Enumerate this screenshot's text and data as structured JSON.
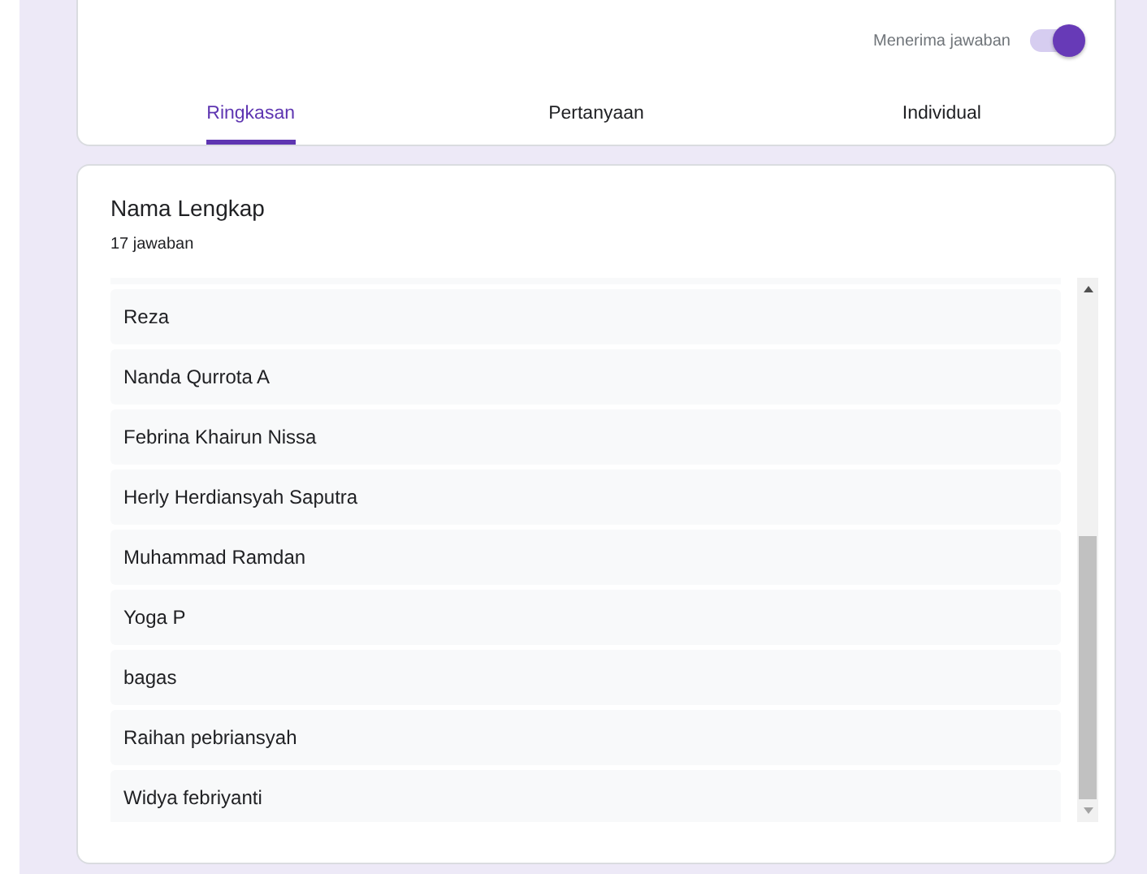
{
  "header": {
    "toggle": {
      "label": "Menerima jawaban",
      "on": true
    }
  },
  "tabs": [
    {
      "label": "Ringkasan",
      "selected": true
    },
    {
      "label": "Pertanyaan",
      "selected": false
    },
    {
      "label": "Individual",
      "selected": false
    }
  ],
  "question": {
    "title": "Nama Lengkap",
    "count": "17 jawaban",
    "responses": [
      "Reza",
      "Nanda Qurrota A",
      "Febrina Khairun Nissa",
      "Herly Herdiansyah Saputra",
      "Muhammad Ramdan",
      "Yoga P",
      "bagas",
      "Raihan pebriansyah",
      "Widya febriyanti"
    ]
  }
}
